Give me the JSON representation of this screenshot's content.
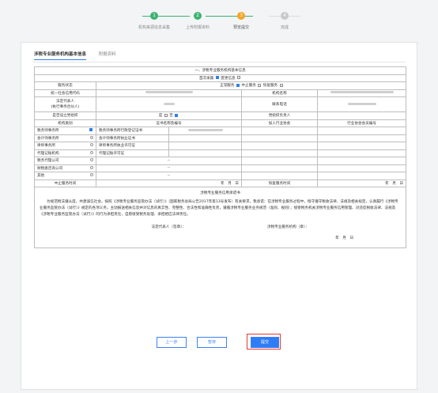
{
  "stepper": {
    "steps": [
      {
        "num": "1",
        "label": "机构来源信息采集",
        "color": "#3cb371"
      },
      {
        "num": "2",
        "label": "上传附报资料",
        "color": "#3cb371"
      },
      {
        "num": "3",
        "label": "预览提交",
        "color": "#f5a623"
      },
      {
        "num": "4",
        "label": "完成",
        "color": "#c9c9c9"
      }
    ]
  },
  "tabs": [
    "涉税专业服务机构基本信息",
    "附报资料"
  ],
  "form": {
    "section_title": "一、涉税专业服务机构基本信息",
    "first_collect": "首次采集",
    "change_info": "变更信息",
    "service_status_label": "服务状态",
    "status_normal": "正常服务",
    "status_stop": "中止服务",
    "status_resume": "恢复服务",
    "credit_code_label": "统一社会信用代码",
    "org_name_label": "机构名称",
    "legal_rep_label": "法定代表人\n(执行事务合伙人)",
    "contact_phone_label": "联系电话",
    "party_org_label": "是否设立党组织",
    "yes": "是",
    "no": "否",
    "party_leader_label": "党组织负责人",
    "col_org_type": "机构类别",
    "col_cert": "证书名称及编号",
    "col_assoc": "加入行业协会",
    "col_assoc_no": "行业协会会员编号",
    "rows": [
      {
        "type": "税务师事务所",
        "cert": "税务师事务所行政登记证书",
        "checked": true
      },
      {
        "type": "会计师事务所",
        "cert": "会计师事务所执业证书",
        "checked": false
      },
      {
        "type": "律师事务所",
        "cert": "律师事务所执业许可证",
        "checked": false
      },
      {
        "type": "代理记账机构",
        "cert": "代理记账许可证",
        "checked": false
      },
      {
        "type": "税务代理公司",
        "cert": "--",
        "checked": false
      },
      {
        "type": "财税类咨询公司",
        "cert": "--",
        "checked": false
      },
      {
        "type": "其他",
        "cert": "--",
        "checked": false
      }
    ],
    "suspend_time_label": "中止服务时间",
    "ymd": "年　月　日",
    "resume_time_label": "恢复服务时间",
    "commit_title": "涉税专业服务信用承诺书",
    "commit_body": "为规范税法遵从度，共建诚信社会，按照《涉税专业服务监管办法（试行）》（国家税务总局公告2017年第13号发布）有关要求，我承诺：在涉税专业服务过程中，恪守遵守税收法律、法规及相关规定，认真履行《涉税专业服务监管办法（试行）》规定的各项义务，主动报送相关信息并对信息的真实性、完整性、合法性和准确性负责，遵循涉税专业服务业务规范（准则、规则）；接受税务机关涉税专业服务信用管理、对违反税收法律、法规及《涉税专业服务监管办法（试行）》的行为承担责任，自愿接受税务处理、承担相应法律责任。",
    "sign_legal": "法定代表人（签章）：",
    "sign_org": "涉税专业服务机构（章）：",
    "sign_date": "年　月　日"
  },
  "buttons": {
    "prev": "上一步",
    "save": "暂存",
    "submit": "提交"
  }
}
